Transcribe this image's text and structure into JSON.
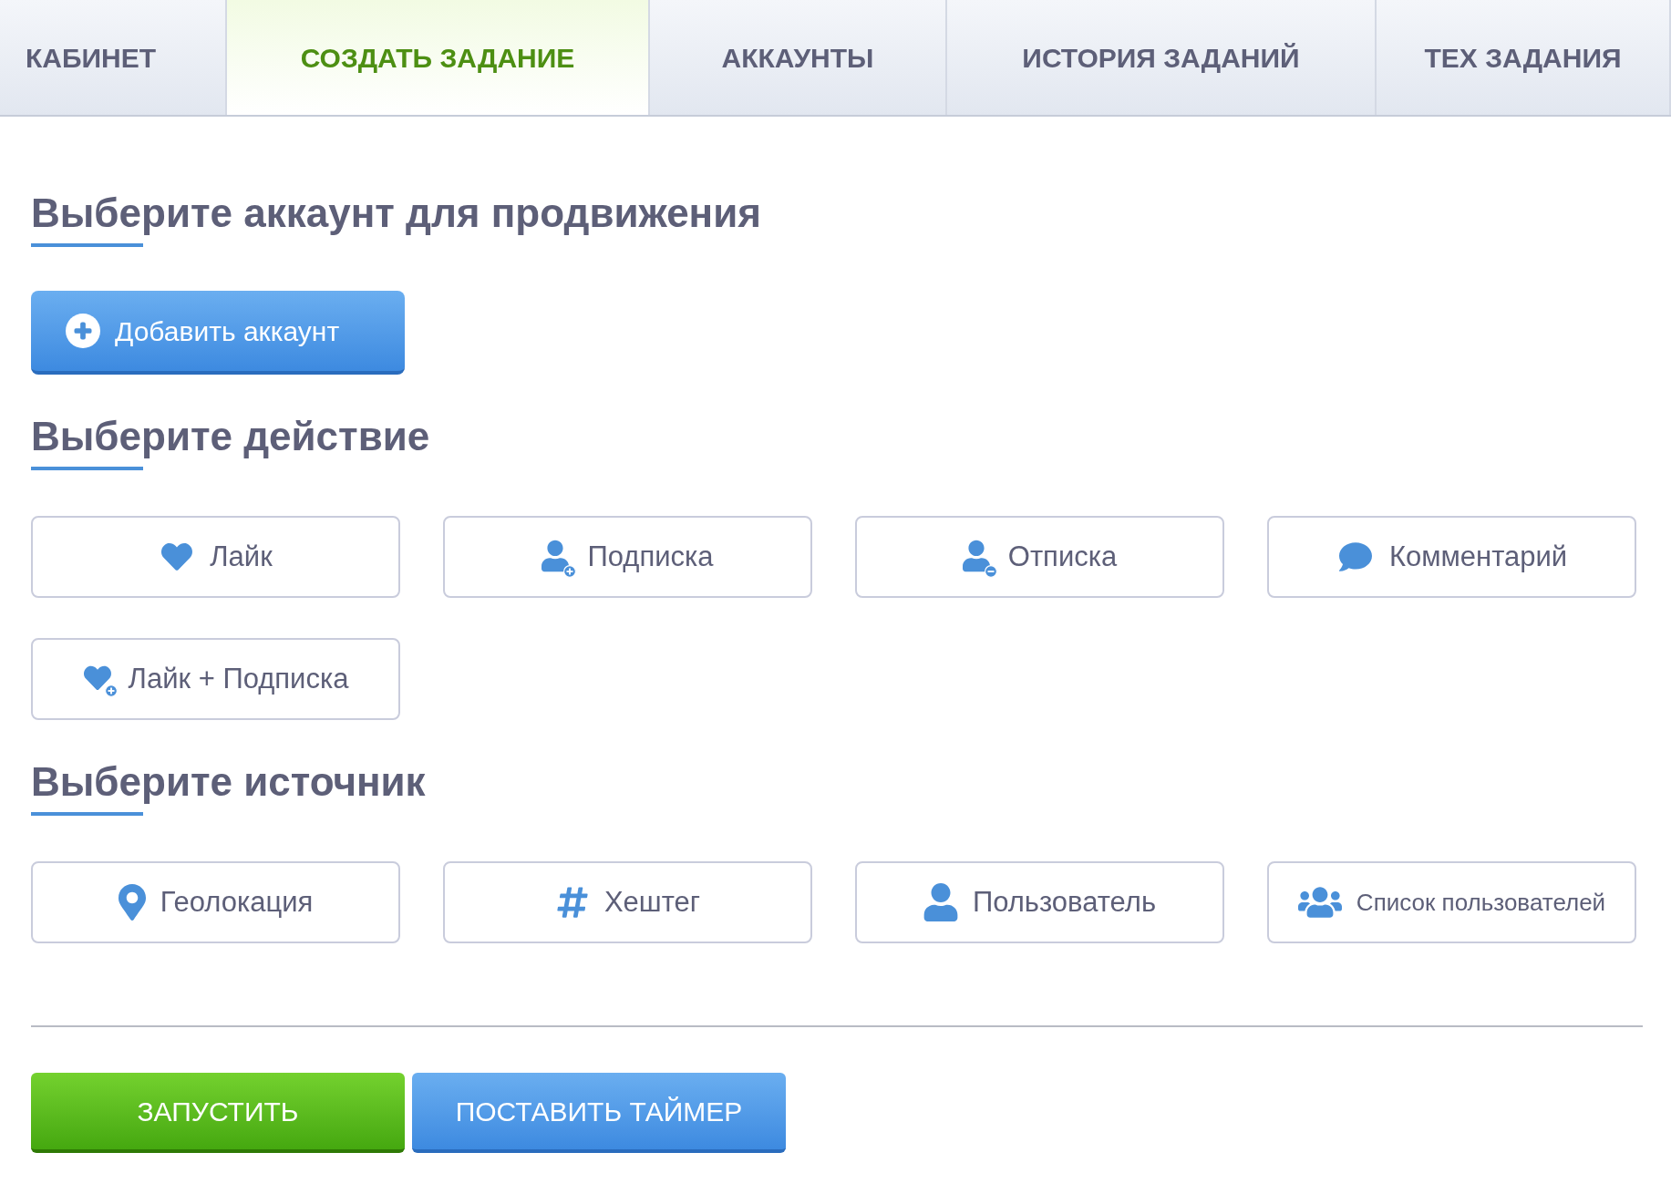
{
  "tabs": [
    {
      "label": "КАБИНЕТ",
      "selected": false
    },
    {
      "label": "СОЗДАТЬ ЗАДАНИЕ",
      "selected": true
    },
    {
      "label": "АККАУНТЫ",
      "selected": false
    },
    {
      "label": "ИСТОРИЯ ЗАДАНИЙ",
      "selected": false
    },
    {
      "label": "ТЕХ ЗАДАНИЯ",
      "selected": false
    }
  ],
  "account_section": {
    "heading": "Выберите аккаунт для продвижения",
    "add_button": "Добавить аккаунт"
  },
  "action_section": {
    "heading": "Выберите действие",
    "options": [
      {
        "label": "Лайк",
        "kind": "like"
      },
      {
        "label": "Подписка",
        "kind": "follow"
      },
      {
        "label": "Отписка",
        "kind": "unfollow"
      },
      {
        "label": "Комментарий",
        "kind": "comment"
      },
      {
        "label": "Лайк + Подписка",
        "kind": "like_follow"
      }
    ]
  },
  "source_section": {
    "heading": "Выберите источник",
    "options": [
      {
        "label": "Геолокация",
        "kind": "geo"
      },
      {
        "label": "Хештег",
        "kind": "hashtag"
      },
      {
        "label": "Пользователь",
        "kind": "user"
      },
      {
        "label": "Список пользователей",
        "kind": "user_list"
      }
    ]
  },
  "footer_buttons": [
    {
      "label": "ЗАПУСТИТЬ",
      "kind": "start"
    },
    {
      "label": "ПОСТАВИТЬ ТАЙМЕР",
      "kind": "timer"
    }
  ]
}
